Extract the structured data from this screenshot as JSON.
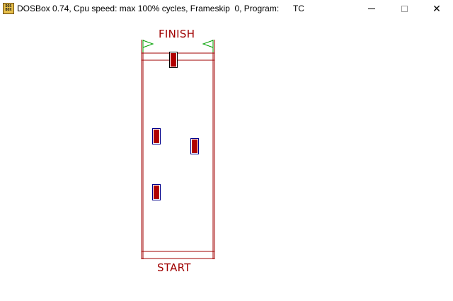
{
  "window": {
    "title": "DOSBox 0.74, Cpu speed: max 100% cycles, Frameskip  0, Program:      TC",
    "icon": "dosbox-icon",
    "icon_text_top": "DOS",
    "icon_text_bottom": "BOX",
    "controls": {
      "minimize": "minimize-icon",
      "maximize": "maximize-icon",
      "close": "✕"
    }
  },
  "game": {
    "finish_label": "FINISH",
    "start_label": "START",
    "colors": {
      "track": "#a00000",
      "car_fill": "#b00000",
      "car_outline": "#00008b",
      "flag": "#00a000",
      "background": "#ffffff"
    }
  }
}
